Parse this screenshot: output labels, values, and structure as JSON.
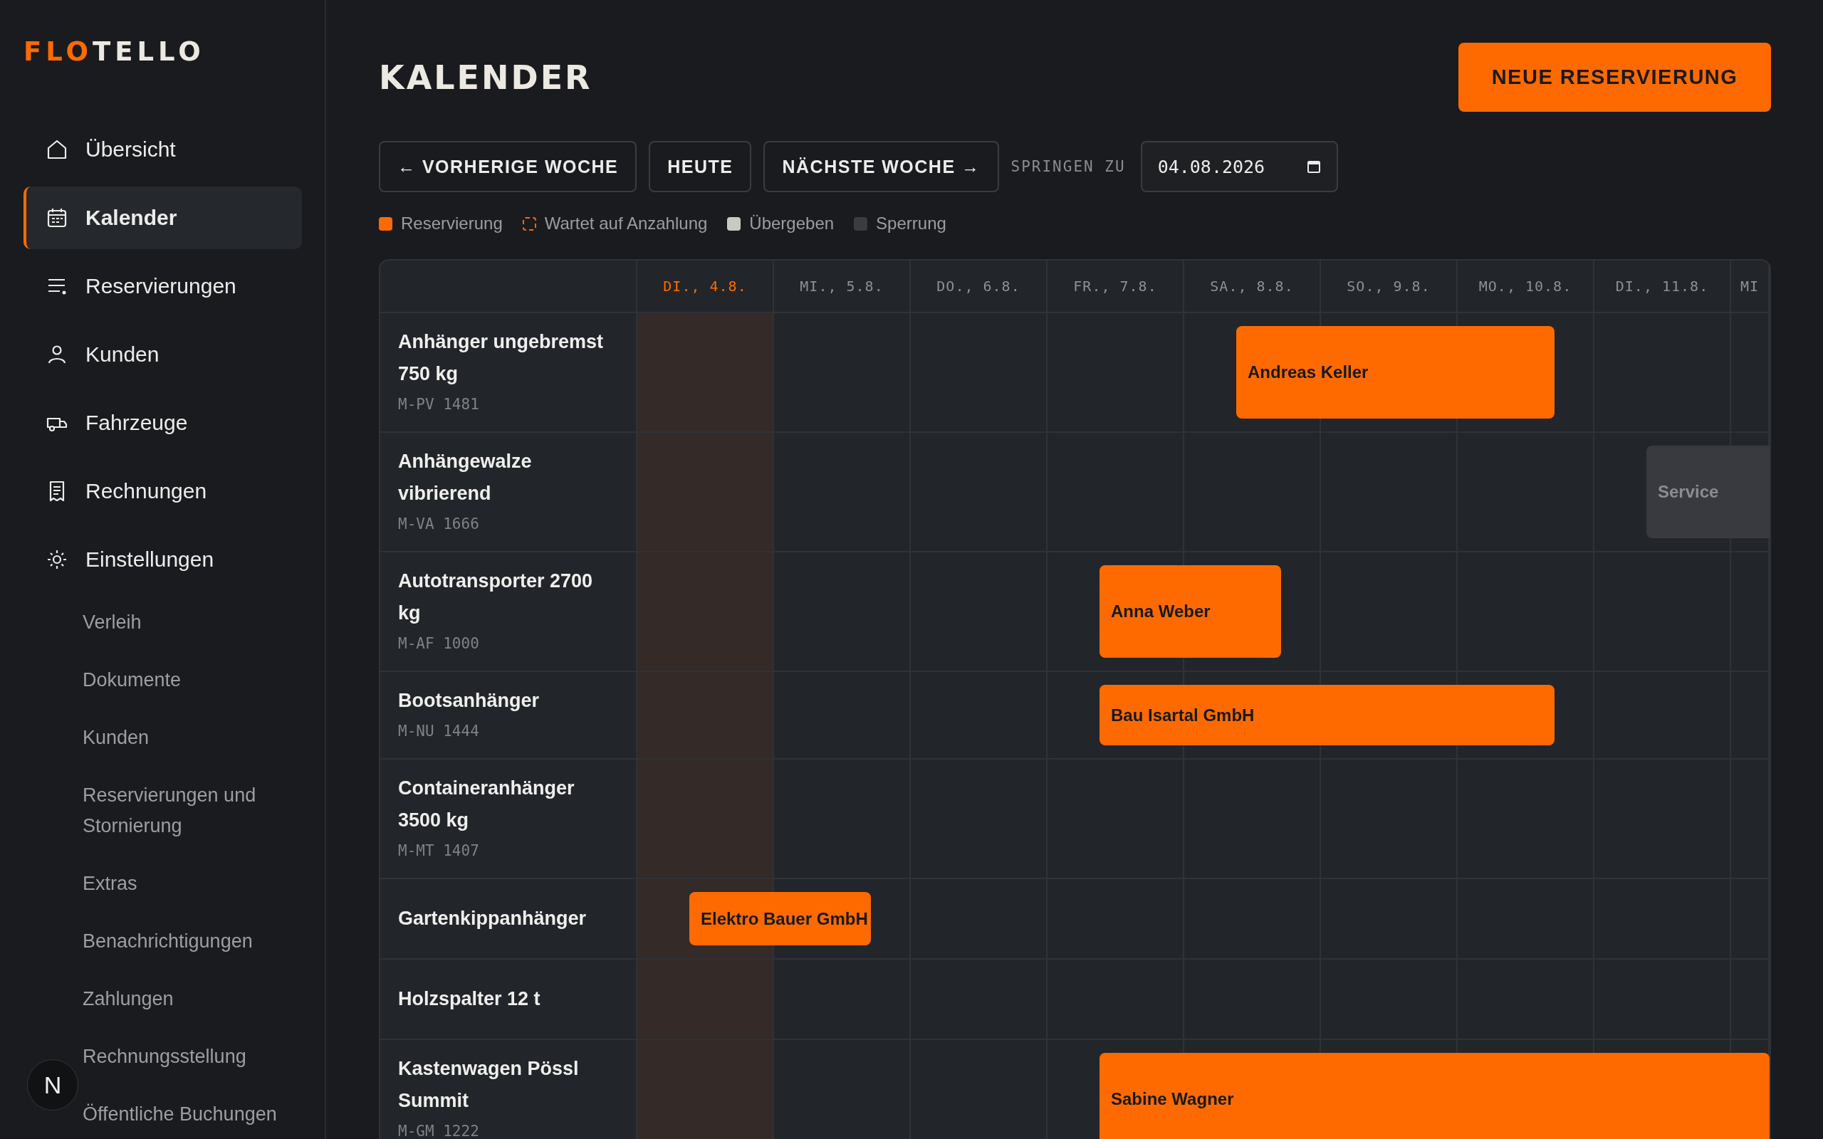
{
  "sidebar": {
    "logo": {
      "accent": "FLO",
      "text": "TELLO"
    },
    "items": [
      {
        "label": "Übersicht",
        "selected": false
      },
      {
        "label": "Kalender",
        "selected": true
      },
      {
        "label": "Reservierungen",
        "selected": false
      },
      {
        "label": "Kunden",
        "selected": false
      },
      {
        "label": "Fahrzeuge",
        "selected": false
      },
      {
        "label": "Rechnungen",
        "selected": false
      },
      {
        "label": "Einstellungen",
        "selected": false,
        "children": [
          {
            "label": "Verleih"
          },
          {
            "label": "Dokumente"
          },
          {
            "label": "Kunden"
          },
          {
            "label": "Reservierungen und Stornierung"
          },
          {
            "label": "Extras"
          },
          {
            "label": "Benachrichtigungen"
          },
          {
            "label": "Zahlungen"
          },
          {
            "label": "Rechnungsstellung"
          },
          {
            "label": "Öffentliche Buchungen"
          }
        ]
      }
    ],
    "dev_button": {
      "label": "N"
    }
  },
  "header": {
    "title": "KALENDER",
    "action": "NEUE RESERVIERUNG"
  },
  "toolbar": {
    "buttons": [
      "← VORHERIGE WOCHE",
      "HEUTE",
      "NÄCHSTE WOCHE →"
    ],
    "jump_label": "SPRINGEN ZU",
    "date": {
      "value": "04.08.2026"
    }
  },
  "legend": [
    {
      "label": "Reservierung",
      "kind": "solid",
      "color": "#ff6a00"
    },
    {
      "label": "Wartet auf Anzahlung",
      "kind": "dashed",
      "color": "#ff6a00"
    },
    {
      "label": "Übergeben",
      "kind": "solid",
      "color": "#c9c8c3"
    },
    {
      "label": "Sperrung",
      "kind": "solid",
      "color": "#3a3c42"
    }
  ],
  "calendar": {
    "days": [
      {
        "label": "DI., 4.8.",
        "today": true
      },
      {
        "label": "MI., 5.8.",
        "today": false
      },
      {
        "label": "DO., 6.8.",
        "today": false
      },
      {
        "label": "FR., 7.8.",
        "today": false
      },
      {
        "label": "SA., 8.8.",
        "today": false
      },
      {
        "label": "SO., 9.8.",
        "today": false
      },
      {
        "label": "MO., 10.8.",
        "today": false
      },
      {
        "label": "DI., 11.8.",
        "today": false
      },
      {
        "label": "MI",
        "today": false
      }
    ],
    "rows": [
      {
        "name": "Anhänger ungebremst 750 kg",
        "plate": "M-PV 1481",
        "bookings": [
          {
            "label": "Andreas Keller",
            "kind": "reservation"
          }
        ]
      },
      {
        "name": "Anhängewalze vibrierend",
        "plate": "M-VA 1666",
        "bookings": [
          {
            "label": "Service",
            "kind": "block"
          }
        ]
      },
      {
        "name": "Autotransporter 2700 kg",
        "plate": "M-AF 1000",
        "bookings": [
          {
            "label": "Anna Weber",
            "kind": "reservation"
          }
        ]
      },
      {
        "name": "Bootsanhänger",
        "plate": "M-NU 1444",
        "bookings": [
          {
            "label": "Bau Isartal GmbH",
            "kind": "reservation"
          }
        ]
      },
      {
        "name": "Containeranhänger 3500 kg",
        "plate": "M-MT 1407"
      },
      {
        "name": "Gartenkippanhänger",
        "bookings": [
          {
            "label": "Elektro Bauer GmbH",
            "kind": "reservation"
          }
        ]
      },
      {
        "name": "Holzspalter 12 t"
      },
      {
        "name": "Kastenwagen Pössl Summit",
        "plate": "M-GM 1222",
        "bookings": [
          {
            "label": "Sabine Wagner",
            "kind": "reservation"
          }
        ]
      }
    ]
  }
}
